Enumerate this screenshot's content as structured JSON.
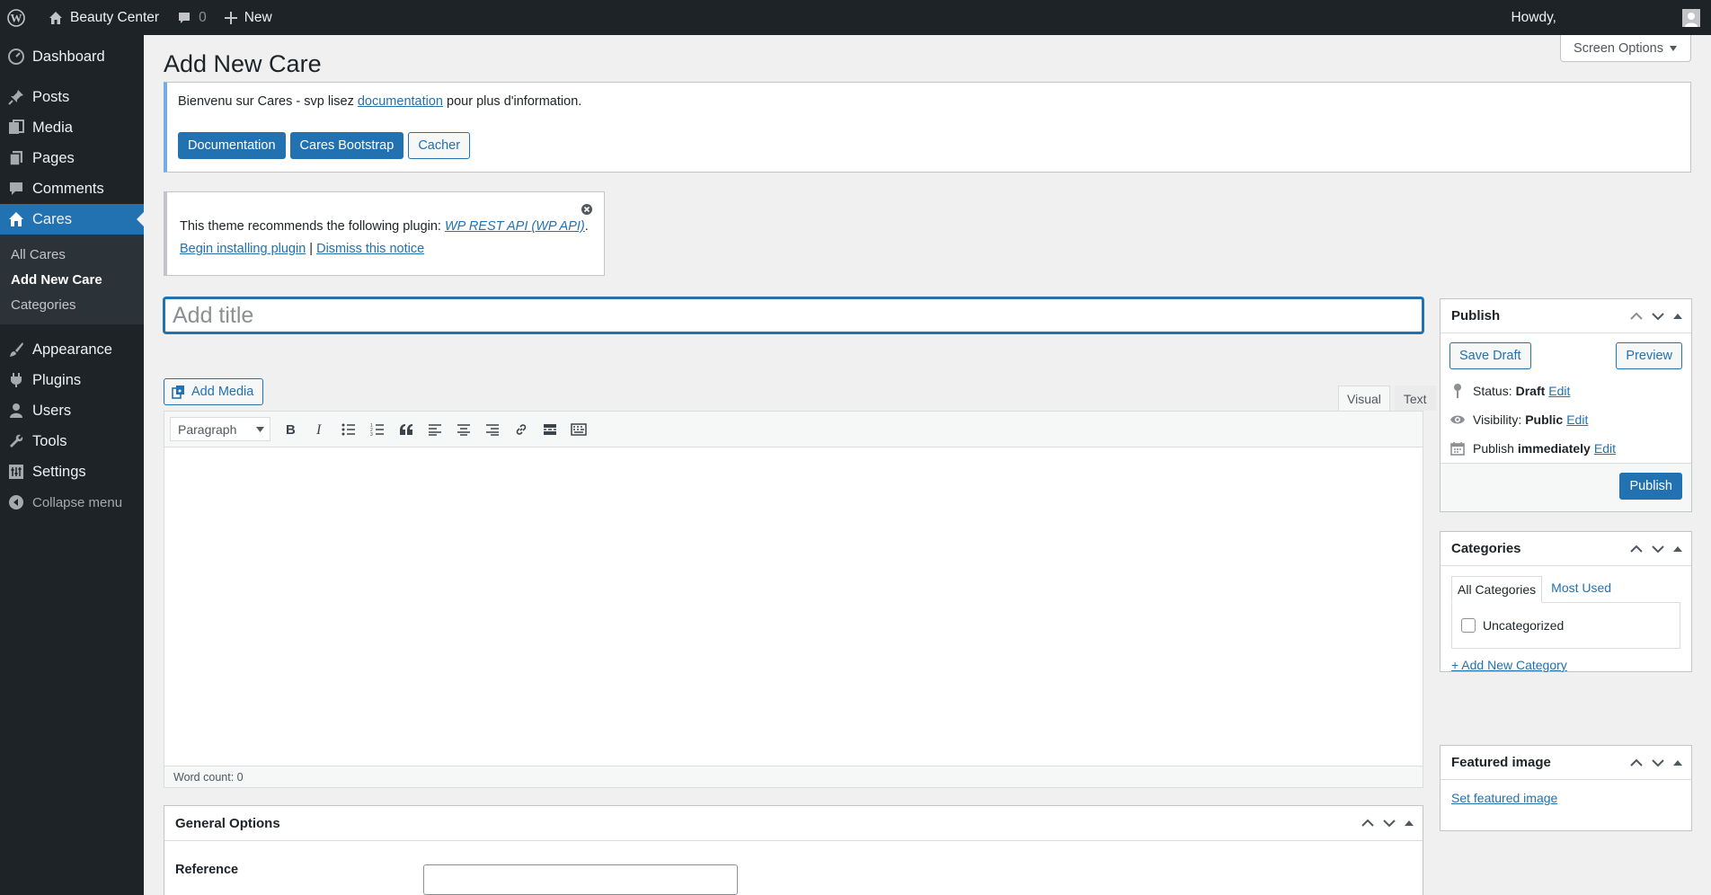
{
  "adminbar": {
    "site_name": "Beauty Center",
    "comments_count": "0",
    "new_label": "New",
    "howdy": "Howdy,"
  },
  "sidebar": {
    "items": [
      {
        "label": "Dashboard",
        "icon": "dashboard-icon"
      },
      {
        "label": "Posts",
        "icon": "pin-icon"
      },
      {
        "label": "Media",
        "icon": "media-icon"
      },
      {
        "label": "Pages",
        "icon": "pages-icon"
      },
      {
        "label": "Comments",
        "icon": "comment-icon"
      },
      {
        "label": "Cares",
        "icon": "home-icon"
      },
      {
        "label": "Appearance",
        "icon": "brush-icon"
      },
      {
        "label": "Plugins",
        "icon": "plugin-icon"
      },
      {
        "label": "Users",
        "icon": "user-icon"
      },
      {
        "label": "Tools",
        "icon": "wrench-icon"
      },
      {
        "label": "Settings",
        "icon": "settings-icon"
      },
      {
        "label": "Collapse menu",
        "icon": "collapse-icon"
      }
    ],
    "submenu": [
      "All Cares",
      "Add New Care",
      "Categories"
    ]
  },
  "page": {
    "title": "Add New Care",
    "screen_options": "Screen Options"
  },
  "welcome_notice": {
    "text_before": "Bienvenu sur Cares - svp lisez ",
    "link": "documentation",
    "text_after": " pour plus d'information.",
    "buttons": [
      "Documentation",
      "Cares Bootstrap",
      "Cacher"
    ]
  },
  "plugin_notice": {
    "text": "This theme recommends the following plugin: ",
    "plugin_link": "WP REST API (WP API)",
    "period": ".",
    "install_link": "Begin installing plugin",
    "separator": " | ",
    "dismiss_link": "Dismiss this notice"
  },
  "editor": {
    "title_placeholder": "Add title",
    "add_media": "Add Media",
    "tab_visual": "Visual",
    "tab_text": "Text",
    "format": "Paragraph",
    "word_count": "Word count: 0"
  },
  "publish": {
    "title": "Publish",
    "save_draft": "Save Draft",
    "preview": "Preview",
    "status_label": "Status:",
    "status_value": "Draft",
    "visibility_label": "Visibility:",
    "visibility_value": "Public",
    "publish_label": "Publish",
    "publish_value": "immediately",
    "edit": "Edit",
    "publish_button": "Publish"
  },
  "categories": {
    "title": "Categories",
    "tab_all": "All Categories",
    "tab_used": "Most Used",
    "item": "Uncategorized",
    "add_new": "+ Add New Category"
  },
  "featured": {
    "title": "Featured image",
    "link": "Set featured image"
  },
  "general_options": {
    "title": "General Options",
    "reference_label": "Reference"
  },
  "colors": {
    "accent": "#2271b1",
    "adminbar": "#1d2327",
    "background": "#f0f0f1"
  }
}
